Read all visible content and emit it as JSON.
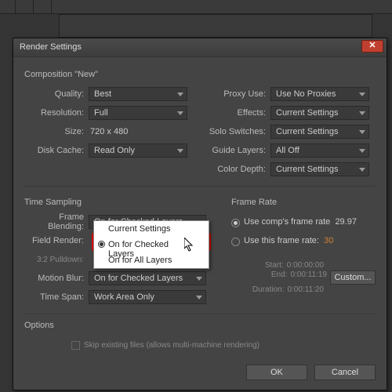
{
  "dialog": {
    "title": "Render Settings"
  },
  "comp": {
    "header": "Composition \"New\"",
    "quality_lbl": "Quality:",
    "quality": "Best",
    "res_lbl": "Resolution:",
    "res": "Full",
    "size_lbl": "Size:",
    "size": "720 x 480",
    "disk_lbl": "Disk Cache:",
    "disk": "Read Only",
    "proxy_lbl": "Proxy Use:",
    "proxy": "Use No Proxies",
    "fx_lbl": "Effects:",
    "fx": "Current Settings",
    "solo_lbl": "Solo Switches:",
    "solo": "Current Settings",
    "guide_lbl": "Guide Layers:",
    "guide": "All Off",
    "cdepth_lbl": "Color Depth:",
    "cdepth": "Current Settings"
  },
  "ts": {
    "header": "Time Sampling",
    "fb_lbl": "Frame Blending:",
    "fb": "On for Checked Layers",
    "fr_lbl": "Field Render:",
    "pd_lbl": "3:2 Pulldown:",
    "mb_lbl": "Motion Blur:",
    "mb": "On for Checked Layers",
    "span_lbl": "Time Span:",
    "span": "Work Area Only"
  },
  "dd": {
    "opt1": "Current Settings",
    "opt2": "On for Checked Layers",
    "opt3": "On for All Layers"
  },
  "fr": {
    "header": "Frame Rate",
    "r1": "Use comp's frame rate",
    "r1v": "29.97",
    "r2": "Use this frame rate:",
    "r2v": "30",
    "start_lbl": "Start:",
    "start": "0:00:00:00",
    "end_lbl": "End:",
    "end": "0:00:11:19",
    "dur_lbl": "Duration:",
    "dur": "0:00:11:20",
    "custom": "Custom..."
  },
  "opt": {
    "header": "Options",
    "skip": "Skip existing files (allows multi-machine rendering)"
  },
  "btn": {
    "ok": "OK",
    "cancel": "Cancel"
  }
}
